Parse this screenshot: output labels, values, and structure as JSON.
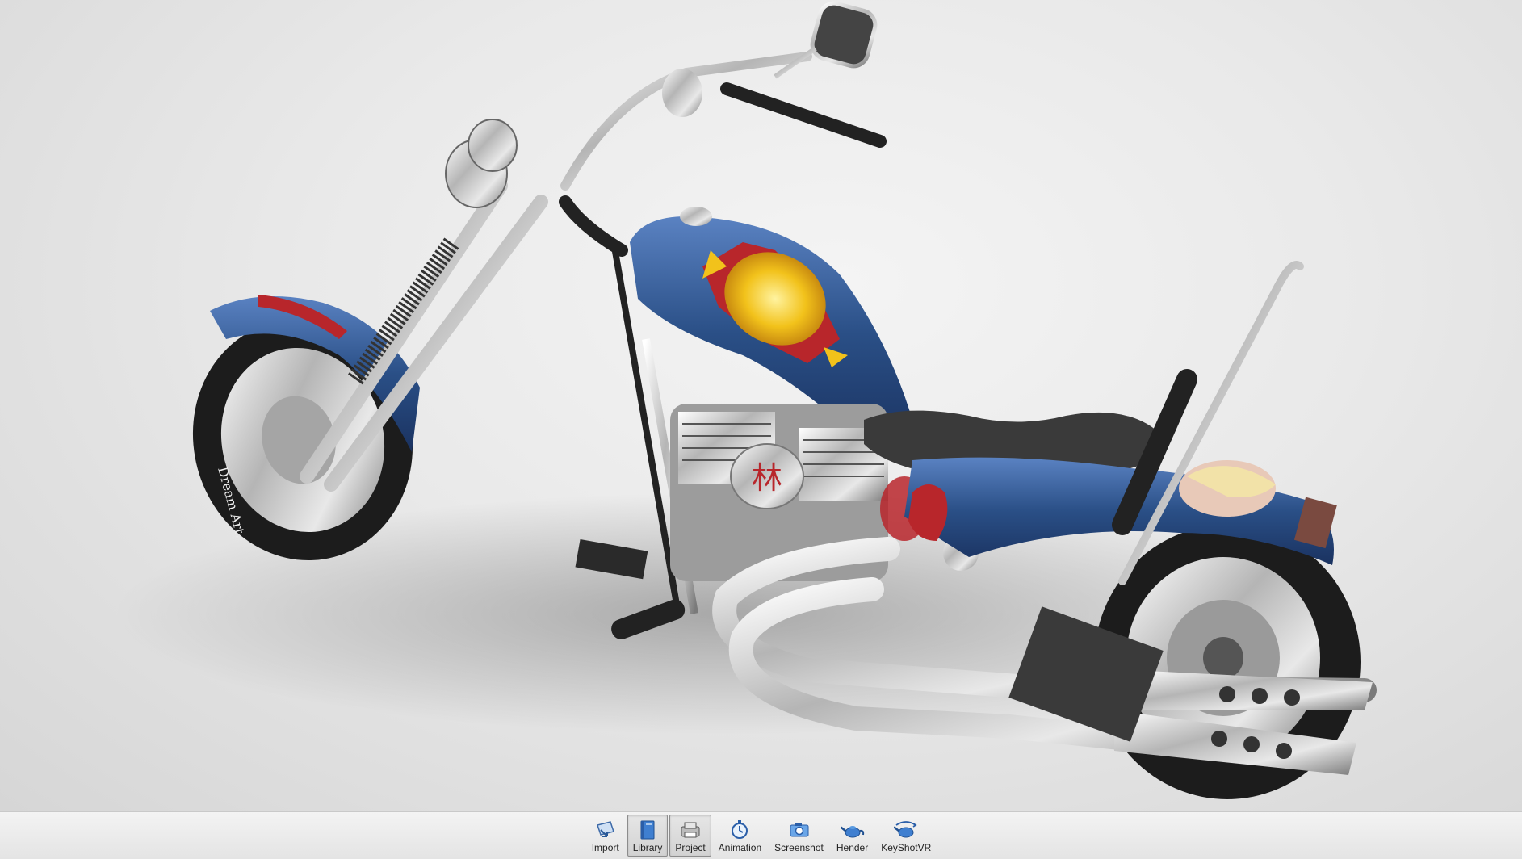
{
  "toolbar": {
    "buttons": [
      {
        "label": "Import",
        "icon": "import-icon",
        "active": false
      },
      {
        "label": "Library",
        "icon": "library-icon",
        "active": true
      },
      {
        "label": "Project",
        "icon": "project-icon",
        "active": true
      },
      {
        "label": "Animation",
        "icon": "animation-icon",
        "active": false
      },
      {
        "label": "Screenshot",
        "icon": "screenshot-icon",
        "active": false
      },
      {
        "label": "Hender",
        "icon": "render-teapot-icon",
        "active": false
      },
      {
        "label": "KeyShotVR",
        "icon": "keyshotvr-icon",
        "active": false
      }
    ]
  },
  "scene": {
    "subject": "chopper-motorcycle",
    "engine_emblem": "林",
    "tire_text": "Dream Art.",
    "colors": {
      "body_blue": "#2a4f86",
      "chrome": "#c8c8c8",
      "seat": "#3a3a3a",
      "flame_gold": "#f2c21b",
      "accent_red": "#b8262b"
    }
  }
}
